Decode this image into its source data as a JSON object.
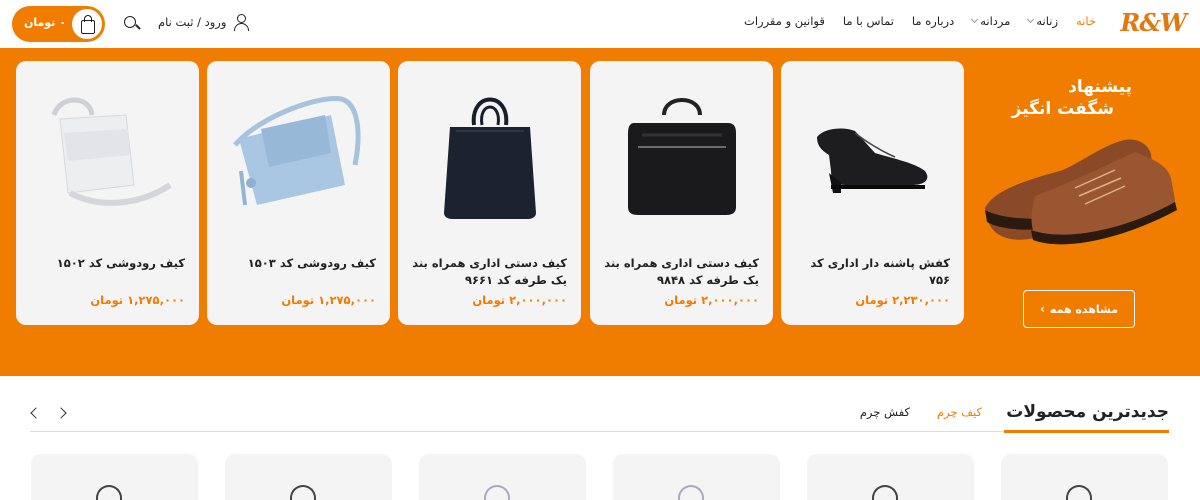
{
  "header": {
    "logo": "R&W",
    "nav": [
      {
        "label": "خانه",
        "active": true,
        "dropdown": false
      },
      {
        "label": "زنانه",
        "active": false,
        "dropdown": true
      },
      {
        "label": "مردانه",
        "active": false,
        "dropdown": true
      },
      {
        "label": "درباره ما",
        "active": false,
        "dropdown": false
      },
      {
        "label": "تماس با ما",
        "active": false,
        "dropdown": false
      },
      {
        "label": "قوانین و مقررات",
        "active": false,
        "dropdown": false
      }
    ],
    "login_label": "ورود / ثبت نام",
    "cart_total": "۰ تومان"
  },
  "banner": {
    "title_line1": "پیشنهاد",
    "title_line2": "شگفت انگیز",
    "view_all": "مشاهده همه",
    "accent": "#f07c00",
    "products": [
      {
        "name": "کفش پاشنه دار اداری کد ۷۵۶",
        "price": "۲,۲۳۰,۰۰۰ تومان",
        "image": "black-shoe-icon"
      },
      {
        "name": "کیف دستی اداری همراه بند یک طرفه کد ۹۸۴۸",
        "price": "۲,۰۰۰,۰۰۰ تومان",
        "image": "black-briefcase-icon"
      },
      {
        "name": "کیف دستی اداری همراه بند یک طرفه کد ۹۶۶۱",
        "price": "۲,۰۰۰,۰۰۰ تومان",
        "image": "navy-handbag-icon"
      },
      {
        "name": "کیف رودوشی کد ۱۵۰۳",
        "price": "۱,۲۷۵,۰۰۰ تومان",
        "image": "blue-shoulder-bag-icon"
      },
      {
        "name": "کیف رودوشی کد ۱۵۰۲",
        "price": "۱,۲۷۵,۰۰۰ تومان",
        "image": "white-shoulder-bag-icon"
      }
    ]
  },
  "newest": {
    "title": "جدیدترین محصولات",
    "tabs": [
      {
        "label": "کیف چرم",
        "active": true
      },
      {
        "label": "کفش چرم",
        "active": false
      }
    ]
  }
}
